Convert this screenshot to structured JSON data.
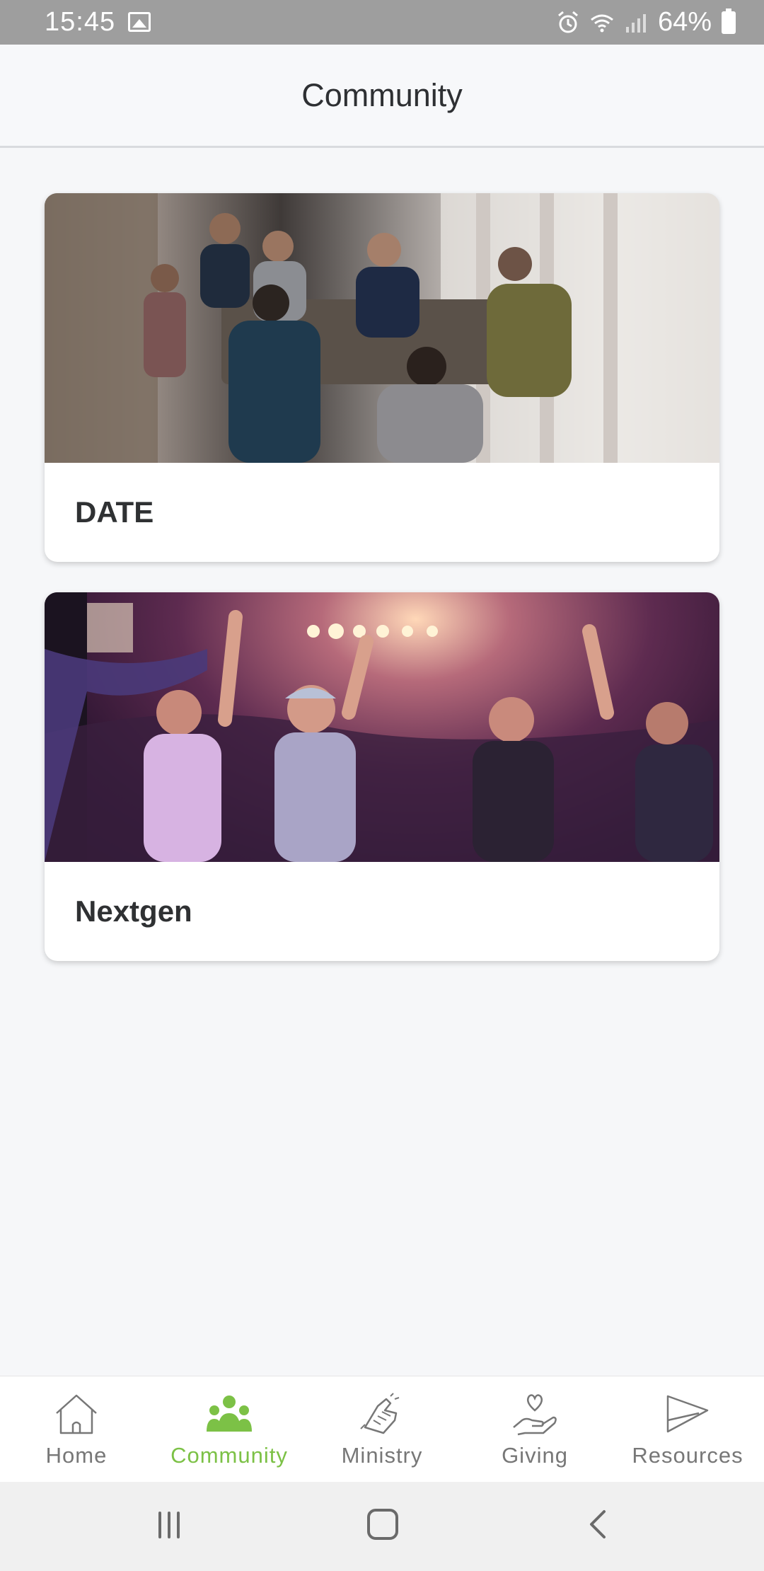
{
  "status_bar": {
    "time": "15:45",
    "battery": "64%",
    "icons": [
      "gallery-icon",
      "alarm-icon",
      "wifi-icon",
      "signal-icon",
      "battery-icon"
    ]
  },
  "header": {
    "title": "Community"
  },
  "cards": [
    {
      "label": "DATE",
      "image": "group-dinner-photo"
    },
    {
      "label": "Nextgen",
      "image": "worship-concert-photo"
    }
  ],
  "bottom_nav": {
    "active": "Community",
    "active_color": "#7cc146",
    "inactive_color": "#777777",
    "items": [
      {
        "label": "Home",
        "icon": "house-icon"
      },
      {
        "label": "Community",
        "icon": "people-icon"
      },
      {
        "label": "Ministry",
        "icon": "hands-icon"
      },
      {
        "label": "Giving",
        "icon": "giving-hand-icon"
      },
      {
        "label": "Resources",
        "icon": "paper-plane-icon"
      }
    ]
  },
  "system_nav": [
    "recents-button",
    "home-button",
    "back-button"
  ]
}
